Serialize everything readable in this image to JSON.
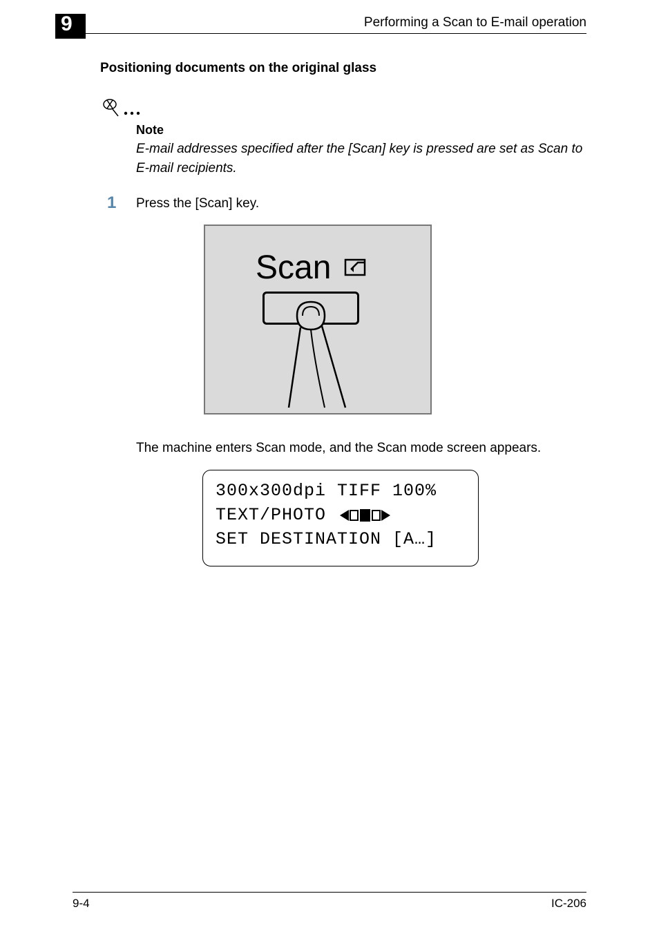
{
  "chapter": "9",
  "header_title": "Performing a Scan to E-mail operation",
  "section_title": "Positioning documents on the original glass",
  "note": {
    "label": "Note",
    "body": "E-mail addresses specified after the [Scan] key is pressed are set as Scan to E-mail recipients."
  },
  "step": {
    "num": "1",
    "text": "Press the [Scan] key."
  },
  "illustration": {
    "button_label": "Scan"
  },
  "result_text": "The machine enters Scan mode, and the Scan mode screen appears.",
  "lcd": {
    "line1": "300x300dpi TIFF 100%",
    "line2_left": "TEXT/PHOTO",
    "line3": "SET DESTINATION [A…]"
  },
  "footer": {
    "left": "9-4",
    "right": "IC-206"
  }
}
